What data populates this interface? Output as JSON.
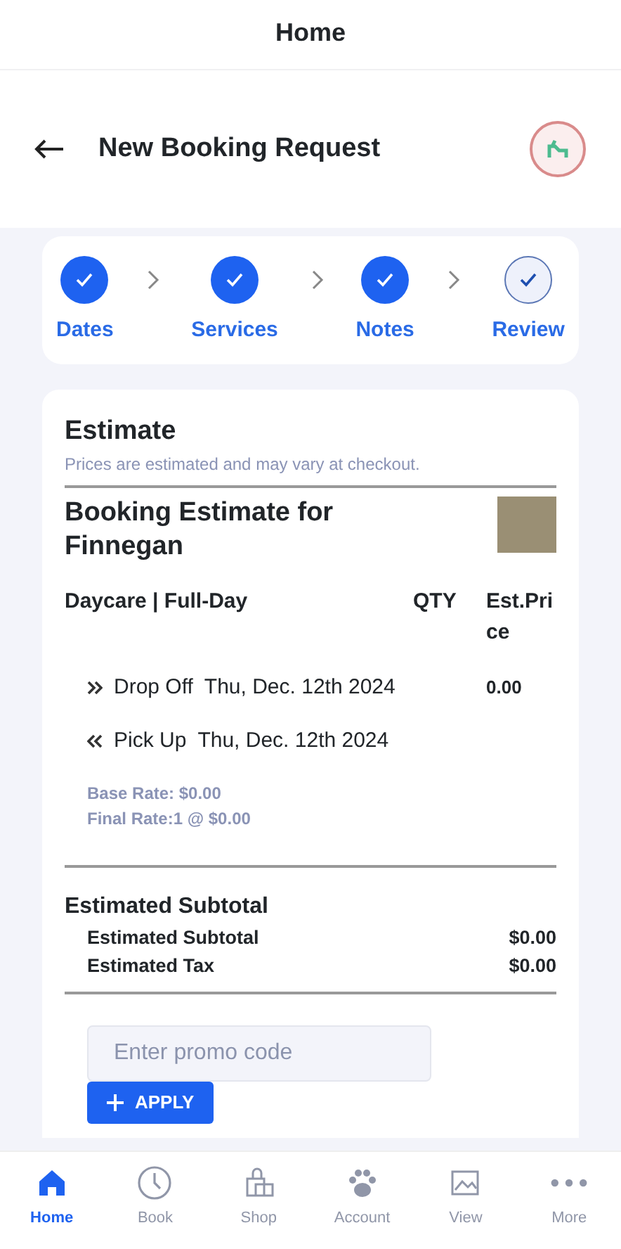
{
  "top_title": "Home",
  "header": {
    "title": "New Booking Request"
  },
  "steps": [
    {
      "label": "Dates",
      "done": true,
      "selected": false
    },
    {
      "label": "Services",
      "done": true,
      "selected": false
    },
    {
      "label": "Notes",
      "done": true,
      "selected": false
    },
    {
      "label": "Review",
      "done": true,
      "selected": true
    }
  ],
  "estimate": {
    "title": "Estimate",
    "subtitle": "Prices are estimated and may vary at checkout.",
    "booking_title": "Booking Estimate for Finnegan",
    "service": "Daycare | Full-Day",
    "qty_header": "QTY",
    "price_header": "Est.Price",
    "lines": [
      {
        "kind": "dropoff",
        "label": "Drop Off",
        "date": "Thu, Dec. 12th 2024",
        "price": "0.00"
      },
      {
        "kind": "pickup",
        "label": "Pick Up",
        "date": "Thu, Dec. 12th 2024"
      }
    ],
    "base_rate": "Base Rate: $0.00",
    "final_rate": "Final Rate:1 @ $0.00"
  },
  "subtotal": {
    "title": "Estimated Subtotal",
    "rows": [
      {
        "label": "Estimated Subtotal",
        "value": "$0.00"
      },
      {
        "label": "Estimated Tax",
        "value": "$0.00"
      }
    ]
  },
  "promo": {
    "placeholder": "Enter promo code",
    "button": "APPLY"
  },
  "tabs": [
    {
      "kind": "home",
      "label": "Home",
      "selected": true
    },
    {
      "kind": "clock",
      "label": "Book",
      "selected": false
    },
    {
      "kind": "shop",
      "label": "Shop",
      "selected": false
    },
    {
      "kind": "paw",
      "label": "Account",
      "selected": false
    },
    {
      "kind": "picture",
      "label": "View",
      "selected": false
    },
    {
      "kind": "more",
      "label": "More",
      "selected": false
    }
  ]
}
